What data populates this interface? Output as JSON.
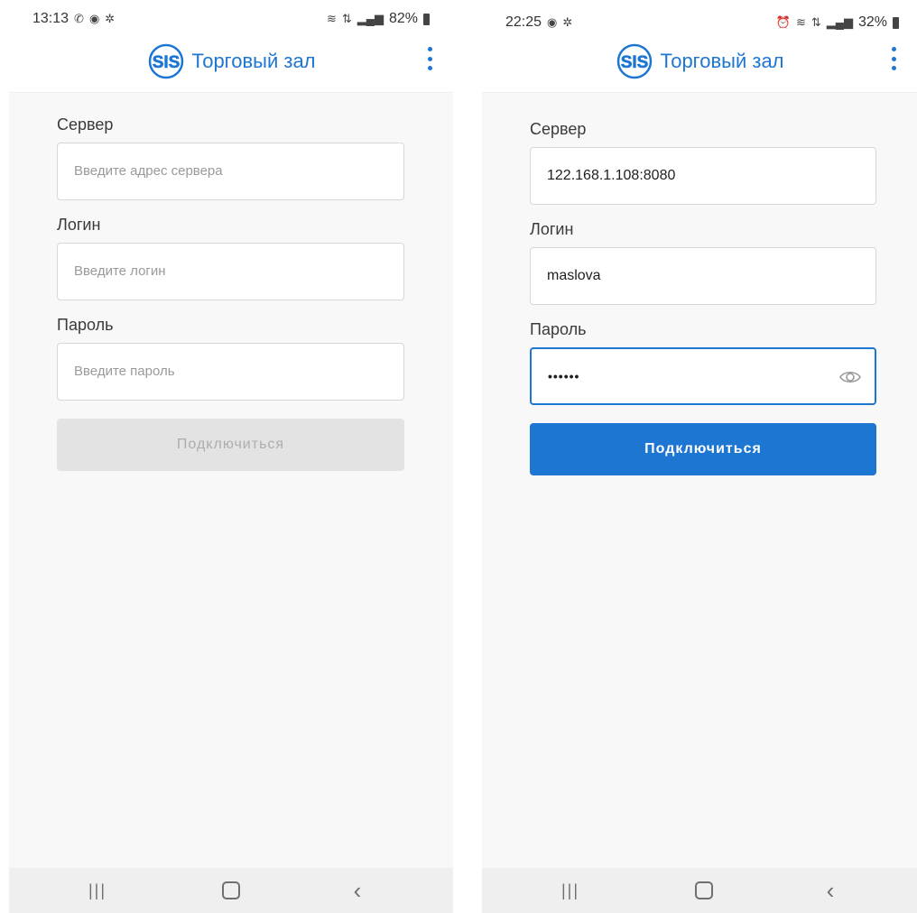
{
  "screens": [
    {
      "statusbar": {
        "time": "13:13",
        "battery_percent": "82%",
        "left_icons": [
          "whatsapp-icon",
          "target-icon",
          "settings-icon"
        ],
        "right_icons": [
          "wifi-icon",
          "data-icon",
          "signal-icon",
          "battery-icon"
        ]
      },
      "appbar": {
        "logo_text": "SIS",
        "title": "Торговый зал",
        "menu_icon": "kebab-menu-icon"
      },
      "form": {
        "server_label": "Сервер",
        "server_value": "",
        "server_placeholder": "Введите адрес сервера",
        "login_label": "Логин",
        "login_value": "",
        "login_placeholder": "Введите логин",
        "password_label": "Пароль",
        "password_value": "",
        "password_placeholder": "Введите пароль",
        "connect_button": "Подключиться",
        "connect_enabled": false
      },
      "navbar": {
        "recents_icon": "recents-icon",
        "home_icon": "home-icon",
        "back_icon": "back-icon"
      }
    },
    {
      "statusbar": {
        "time": "22:25",
        "battery_percent": "32%",
        "left_icons": [
          "target-icon",
          "settings-icon"
        ],
        "right_icons": [
          "alarm-icon",
          "wifi-icon",
          "data-icon",
          "signal-icon",
          "battery-icon"
        ]
      },
      "appbar": {
        "logo_text": "SIS",
        "title": "Торговый зал",
        "menu_icon": "kebab-menu-icon"
      },
      "form": {
        "server_label": "Сервер",
        "server_value": "122.168.1.108:8080",
        "login_label": "Логин",
        "login_value": "maslova",
        "password_label": "Пароль",
        "password_value_masked": "••••••",
        "password_focused": true,
        "connect_button": "Подключиться",
        "connect_enabled": true
      },
      "navbar": {
        "recents_icon": "recents-icon",
        "home_icon": "home-icon",
        "back_icon": "back-icon"
      }
    }
  ],
  "colors": {
    "accent": "#1e76d3",
    "background": "#f8f8f8",
    "disabled_button": "#e3e3e3",
    "disabled_text": "#adadad"
  }
}
